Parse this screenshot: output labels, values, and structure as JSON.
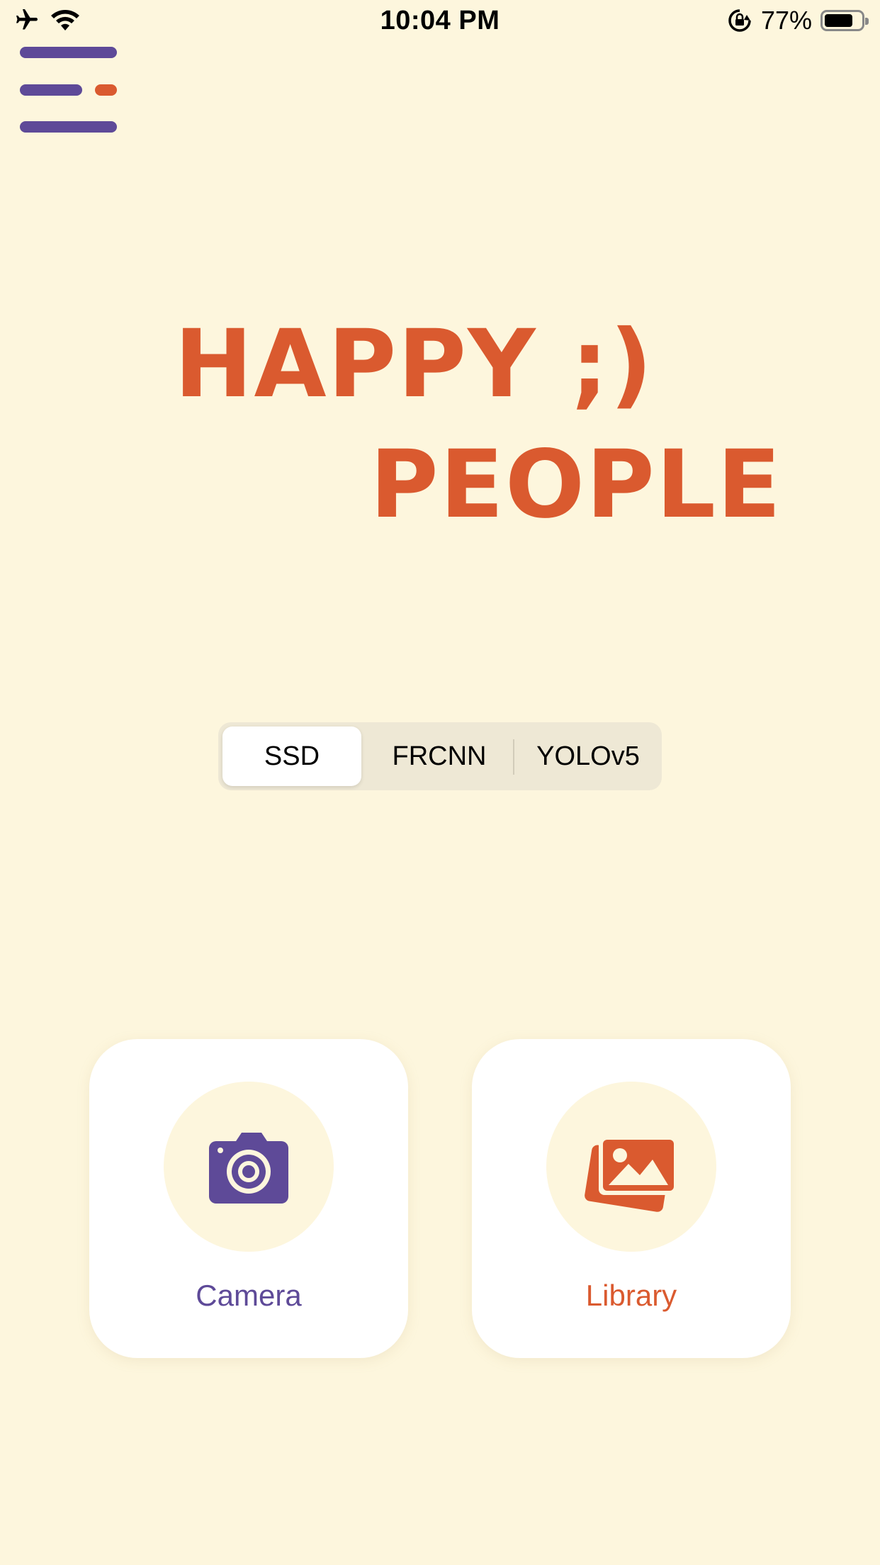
{
  "status_bar": {
    "time": "10:04 PM",
    "battery_percent": "77%",
    "battery_level": 0.77,
    "icons": [
      "airplane-icon",
      "wifi-icon",
      "orientation-lock-icon",
      "battery-icon"
    ]
  },
  "header": {
    "menu_icon": "hamburger-menu-icon"
  },
  "title": {
    "line1": "HAPPY ;)",
    "line2": "PEOPLE",
    "color": "#DA5A2F"
  },
  "model_selector": {
    "options": [
      "SSD",
      "FRCNN",
      "YOLOv5"
    ],
    "selected": "SSD"
  },
  "actions": {
    "camera": {
      "label": "Camera",
      "icon": "camera-icon",
      "color": "#5E4A98"
    },
    "library": {
      "label": "Library",
      "icon": "photo-library-icon",
      "color": "#DA5A2F"
    }
  },
  "colors": {
    "background": "#FDF6DD",
    "accent_purple": "#5E4A98",
    "accent_orange": "#DA5A2F"
  }
}
